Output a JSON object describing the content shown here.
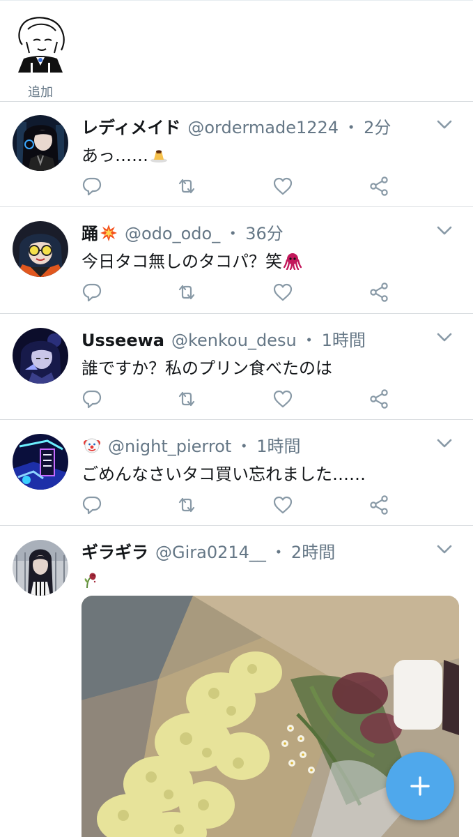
{
  "fleets": {
    "add_label": "追加"
  },
  "tweets": [
    {
      "name": "レディメイド",
      "name_emoji": "",
      "handle": "@ordermade1224",
      "separator": "・",
      "time": "2分",
      "text": "あっ……",
      "text_emoji": "pudding",
      "avatar_icon": "dark-haired-character-avatar"
    },
    {
      "name": "踊",
      "name_emoji": "collision",
      "handle": "@odo_odo_",
      "separator": "・",
      "time": "36分",
      "text": "今日タコ無しのタコパ？笑",
      "text_emoji": "octopus",
      "avatar_icon": "goggles-character-avatar"
    },
    {
      "name": "Usseewa",
      "name_emoji": "",
      "handle": "@kenkou_desu",
      "separator": "・",
      "time": "1時間",
      "text": "誰ですか？私のプリン食べたのは",
      "text_emoji": "",
      "avatar_icon": "blue-night-character-avatar"
    },
    {
      "name": "",
      "name_emoji": "clown-face",
      "handle": "@night_pierrot",
      "separator": "・",
      "time": "1時間",
      "text": "ごめんなさいタコ買い忘れました……",
      "text_emoji": "",
      "avatar_icon": "neon-city-avatar"
    },
    {
      "name": "ギラギラ",
      "name_emoji": "",
      "handle": "@Gira0214__",
      "separator": "・",
      "time": "2時間",
      "text": "",
      "text_emoji": "wilted-flower",
      "avatar_icon": "long-haired-character-avatar",
      "media": "bouquet-photo"
    }
  ],
  "icons": {
    "reply": "reply-icon",
    "retweet": "retweet-icon",
    "like": "like-icon",
    "share": "share-icon",
    "menu": "chevron-down-icon",
    "compose": "compose-plus-icon"
  },
  "colors": {
    "accent": "#4fa8ec",
    "secondary_text": "#657786",
    "divider": "#d9dde0"
  }
}
